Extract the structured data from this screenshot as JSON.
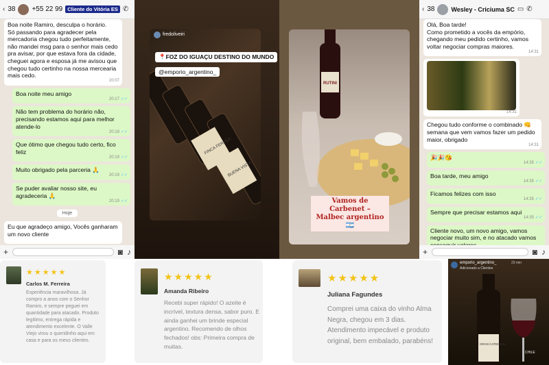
{
  "chat1": {
    "back_count": "38",
    "contact": "+55 22 99",
    "tag": "Cliente do Vitória ES",
    "messages": [
      {
        "dir": "in",
        "text": "Boa noite Ramiro, desculpa o horário.\nSó passando para agradecer pela mercadoria chegou tudo perfeitamente, não mandei msg para o senhor mais cedo pra avisar, por que estava fora da cidade, cheguei agora e esposa já me avisou que chegou tudo certinho na nossa mercearia mais cedo.",
        "time": "20:07"
      },
      {
        "dir": "out",
        "text": "Boa noite meu amigo",
        "time": "20:17"
      },
      {
        "dir": "out",
        "text": "Não tem problema do horário não, precisando estamos aqui para melhor atende-lo",
        "time": "20:18"
      },
      {
        "dir": "out",
        "text": "Que ótimo que chegou tudo certo, fico feliz",
        "time": "20:19"
      },
      {
        "dir": "out",
        "text": "Muito obrigado pela parceria 🙏",
        "time": "20:19"
      },
      {
        "dir": "out",
        "text": "Se puder avaliar nosso site, eu agradeceria 🙏",
        "time": "20:19"
      },
      {
        "dir": "day",
        "text": "Hoje"
      },
      {
        "dir": "in",
        "text": "Eu que agradeço amigo, Vocês ganharam um novo cliente",
        "time": ""
      }
    ]
  },
  "story1": {
    "user": "fredoliveiri",
    "pill": "📍FOZ DO IGUAÇU DESTINO DO MUNDO",
    "handle": "@emporio_argentino_",
    "labels": [
      "FINCA FERRER",
      "BUENA VISTA"
    ]
  },
  "story2": {
    "title_line1": "Vamos de Carbenet –",
    "title_line2": "Malbec argentino 🇦🇷",
    "label": "RUTINI"
  },
  "chat2": {
    "back_count": "38",
    "contact": "Wesley - Criciuma SC",
    "messages": [
      {
        "dir": "in",
        "text": "Olá, Boa tarde!\nComo prometido a vocês da empório, chegando meu pedido certinho, vamos voltar negociar compras maiores.",
        "time": "14:31"
      },
      {
        "dir": "img",
        "time": "14:31"
      },
      {
        "dir": "in",
        "text": "Chegou tudo conforme o combinado 👊 semana que vem vamos fazer um pedido maior, obrigado",
        "time": "14:31"
      },
      {
        "dir": "out",
        "text": "🎉🎉😘",
        "time": "14:35"
      },
      {
        "dir": "out",
        "text": "Boa tarde, meu amigo",
        "time": "14:35"
      },
      {
        "dir": "out",
        "text": "Ficamos felizes com isso",
        "time": "14:35"
      },
      {
        "dir": "out",
        "text": "Sempre que precisar estamos aqui",
        "time": "14:35"
      },
      {
        "dir": "out",
        "text": "Cliente novo, um novo amigo, vamos negociar muito sim, e no atacado vamos conseguir valores",
        "time": ""
      }
    ]
  },
  "reviews": [
    {
      "stars": "★★★★★",
      "name": "Carlos M. Ferreira",
      "text": "Experiência maravilhosa. Já compro a anos com o Senhor Ramiro, e sempre peguei em quantidade para atacado. Produto legítimo, entrega rápida e atendimento excelente. O Valle Viejo virou o queridinho aqui em casa e para os meus clientes."
    },
    {
      "stars": "★★★★★",
      "name": "Amanda Ribeiro",
      "text": "Recebi super rápido! O azeite é incrível, textura densa, sabor puro. E ainda ganhei um brinde especial argentino. Recomendo de olhos fechados! obs: Primeira compra de muitas."
    },
    {
      "stars": "★★★★★",
      "name": "Juliana Fagundes",
      "text": "Comprei uma caixa do vinho Alma Negra, chegou em 3 dias. Atendimento impecável e produto original, bem embalado, parabéns!"
    }
  ],
  "story3": {
    "user": "emporio_argentino_",
    "time": "23 min",
    "sub": "Adicionado a Clientes",
    "label1": "GRAN CATEDRAL",
    "label2": "CHILE"
  }
}
